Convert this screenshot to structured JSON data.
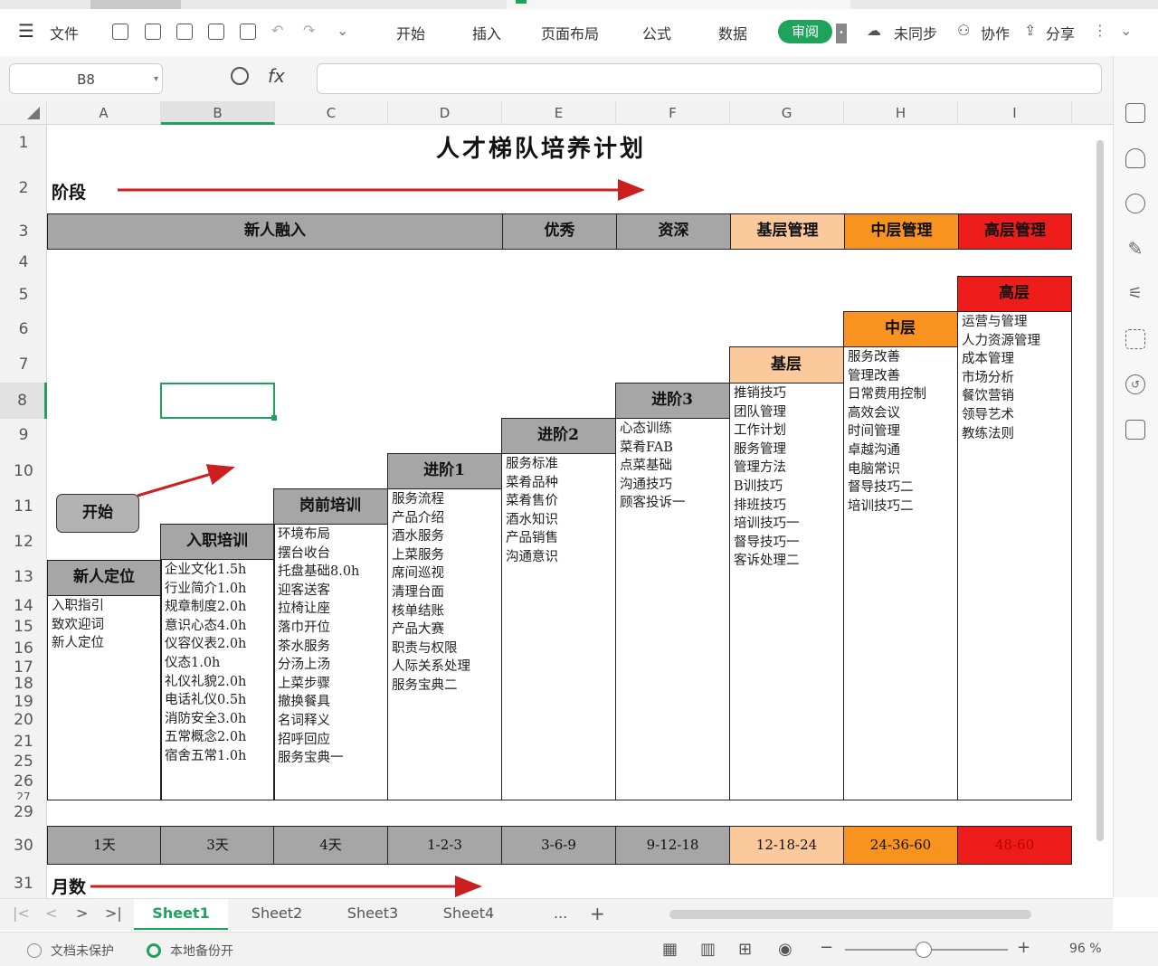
{
  "toolbar": {
    "file": "文件",
    "menus": [
      "开始",
      "插入",
      "页面布局",
      "公式",
      "数据"
    ],
    "review": "审阅",
    "sync": "未同步",
    "collab": "协作",
    "share": "分享"
  },
  "formula_bar": {
    "cell_ref": "B8",
    "fx": "fx",
    "value": ""
  },
  "columns": [
    "A",
    "B",
    "C",
    "D",
    "E",
    "F",
    "G",
    "H",
    "I"
  ],
  "rows": [
    "1",
    "2",
    "3",
    "4",
    "5",
    "6",
    "7",
    "8",
    "9",
    "10",
    "11",
    "12",
    "13",
    "14",
    "15",
    "16",
    "17",
    "18",
    "19",
    "20",
    "21",
    "25",
    "26",
    "27",
    "29",
    "30",
    "31"
  ],
  "sheet": {
    "title": "人才梯队培养计划",
    "stage_label": "阶段",
    "month_label": "月数",
    "start_label": "开始",
    "stage_groups": [
      {
        "label": "新人融入",
        "color": "#a6a6a6"
      },
      {
        "label": "优秀",
        "color": "#a6a6a6"
      },
      {
        "label": "资深",
        "color": "#a6a6a6"
      },
      {
        "label": "基层管理",
        "color": "#fbc99b"
      },
      {
        "label": "中层管理",
        "color": "#f7931e"
      },
      {
        "label": "高层管理",
        "color": "#ef1c1c"
      }
    ],
    "steps": [
      {
        "header": "新人定位",
        "items": [
          "入职指引",
          "致欢迎词",
          "新人定位"
        ]
      },
      {
        "header": "入职培训",
        "items": [
          "企业文化1.5h",
          "行业简介1.0h",
          "规章制度2.0h",
          "意识心态4.0h",
          "仪容仪表2.0h",
          "仪态1.0h",
          "礼仪礼貌2.0h",
          "电话礼仪0.5h",
          "消防安全3.0h",
          "五常概念2.0h",
          "宿舍五常1.0h"
        ]
      },
      {
        "header": "岗前培训",
        "items": [
          "环境布局",
          "摆台收台",
          "托盘基础8.0h",
          "迎客送客",
          "拉椅让座",
          "落巾开位",
          "茶水服务",
          "分汤上汤",
          "上菜步骤",
          "撤换餐具",
          "名词释义",
          "招呼回应",
          "服务宝典一"
        ]
      },
      {
        "header": "进阶1",
        "items": [
          "服务流程",
          "产品介绍",
          "酒水服务",
          "上菜服务",
          "席间巡视",
          "清理台面",
          "核单结账",
          "产品大赛",
          "职责与权限",
          "人际关系处理",
          "服务宝典二"
        ]
      },
      {
        "header": "进阶2",
        "items": [
          "服务标准",
          "菜肴品种",
          "菜肴售价",
          "酒水知识",
          "产品销售",
          "沟通意识"
        ]
      },
      {
        "header": "进阶3",
        "items": [
          "心态训练",
          "菜肴FAB",
          "点菜基础",
          "沟通技巧",
          "顾客投诉一"
        ]
      },
      {
        "header": "基层",
        "items": [
          "推销技巧",
          "团队管理",
          "工作计划",
          "服务管理",
          "管理方法",
          "B训技巧",
          "排班技巧",
          "培训技巧一",
          "督导技巧一",
          "客诉处理二"
        ]
      },
      {
        "header": "中层",
        "items": [
          "服务改善",
          "管理改善",
          "日常费用控制",
          "高效会议",
          "时间管理",
          "卓越沟通",
          "电脑常识",
          "督导技巧二",
          "培训技巧二"
        ]
      },
      {
        "header": "高层",
        "items": [
          "运营与管理",
          "人力资源管理",
          "成本管理",
          "市场分析",
          "餐饮营销",
          "领导艺术",
          "教练法则"
        ]
      }
    ],
    "months": [
      "1天",
      "3天",
      "4天",
      "1-2-3",
      "3-6-9",
      "9-12-18",
      "12-18-24",
      "24-36-60",
      "48-60"
    ]
  },
  "tabs": [
    "Sheet1",
    "Sheet2",
    "Sheet3",
    "Sheet4"
  ],
  "tab_more": "...",
  "tab_add": "+",
  "status": {
    "protect": "文档未保护",
    "backup": "本地备份开",
    "zoom": "96 %"
  },
  "colors": {
    "accent": "#1fa35c",
    "grey": "#a6a6a6",
    "light_orange": "#fbc99b",
    "orange": "#f7931e",
    "red": "#ef1c1c",
    "arrow": "#cc1f1f"
  }
}
